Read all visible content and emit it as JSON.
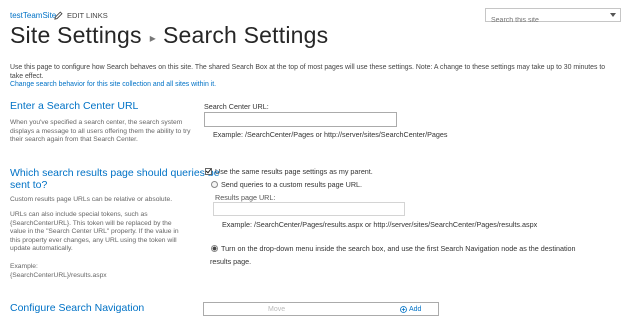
{
  "header": {
    "site_name": "testTeamSite",
    "edit_links": "EDIT LINKS",
    "search_placeholder": "Search this site"
  },
  "page": {
    "title_parent": "Site Settings",
    "title_current": "Search Settings"
  },
  "intro": {
    "text": "Use this page to configure how Search behaves on this site. The shared Search Box at the top of most pages will use these settings. Note: A change to these settings may take up to 30 minutes to take effect.",
    "link": "Change search behavior for this site collection and all sites within it."
  },
  "search_center": {
    "heading": "Enter a Search Center URL",
    "description": "When you've specified a search center, the search system displays a message to all users offering them the ability to try their search again from that Search Center.",
    "field_label": "Search Center URL:",
    "field_value": "",
    "example": "Example: /SearchCenter/Pages or http://server/sites/SearchCenter/Pages"
  },
  "results_page": {
    "heading_line1": "Which search results page should queries be",
    "heading_line2": "sent to?",
    "desc1": "Custom results page URLs can be relative or absolute.",
    "desc2_lines": [
      "URLs can also include special tokens, such as",
      "{SearchCenterURL}. This token will be replaced by the",
      "value in the \"Search Center URL\" property. If the value in",
      "this property ever changes, any URL using the token will",
      "update automatically."
    ],
    "desc3_line1": "Example:",
    "desc3_line2": "{SearchCenterURL}/results.aspx",
    "use_parent_label": "Use the same results page settings as my parent.",
    "use_parent_checked": true,
    "custom_option_label": "Send queries to a custom results page URL.",
    "results_url_label": "Results page URL:",
    "results_url_value": "",
    "results_example": "Example: /SearchCenter/Pages/results.aspx or http://server/sites/SearchCenter/Pages/results.aspx",
    "dropdown_option_line1": "Turn on the drop-down menu inside the search box, and use the first Search Navigation node as the destination",
    "dropdown_option_line2": "results page."
  },
  "search_navigation": {
    "heading": "Configure Search Navigation",
    "move_label": "Move",
    "add_label": "Add"
  }
}
